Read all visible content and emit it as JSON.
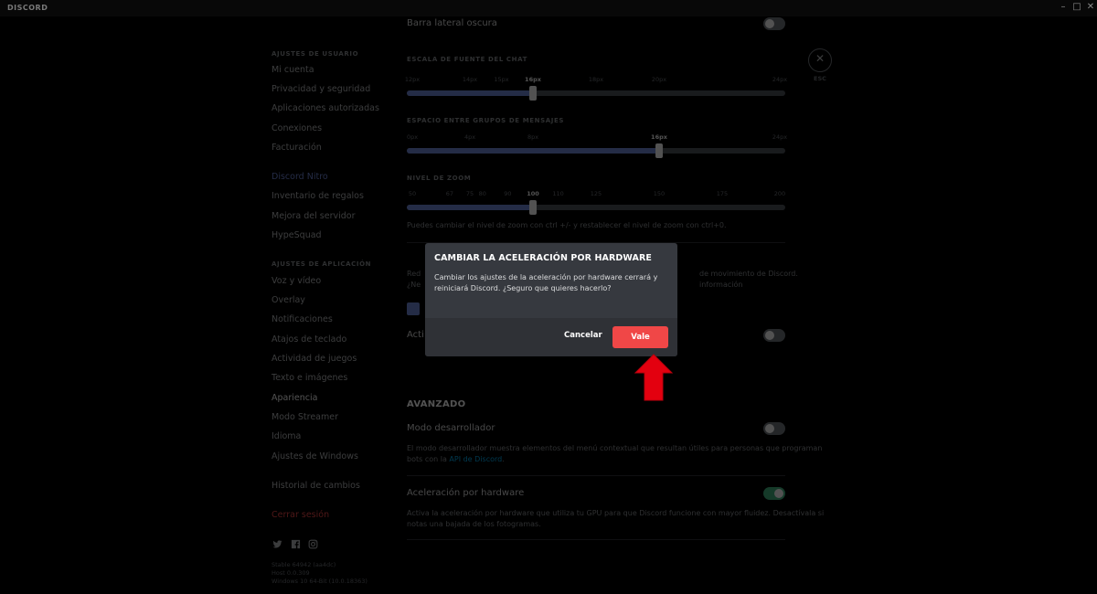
{
  "app": {
    "title": "DISCORD",
    "window_min": "–",
    "window_max": "□",
    "window_close": "✕"
  },
  "sidebar": {
    "user_settings_header": "AJUSTES DE USUARIO",
    "user_items": [
      "Mi cuenta",
      "Privacidad y seguridad",
      "Aplicaciones autorizadas",
      "Conexiones",
      "Facturación"
    ],
    "nitro_item": "Discord Nitro",
    "mid_items": [
      "Inventario de regalos",
      "Mejora del servidor",
      "HypeSquad"
    ],
    "app_settings_header": "AJUSTES DE APLICACIÓN",
    "app_items": [
      "Voz y vídeo",
      "Overlay",
      "Notificaciones",
      "Atajos de teclado",
      "Actividad de juegos",
      "Texto e imágenes",
      "Apariencia",
      "Modo Streamer",
      "Idioma",
      "Ajustes de Windows"
    ],
    "changelog": "Historial de cambios",
    "logout": "Cerrar sesión",
    "social_icons": [
      "twitter-icon",
      "facebook-icon",
      "instagram-icon"
    ],
    "footer": [
      "Stable 64942 (aa4dc)",
      "Host 0.0.309",
      "Windows 10 64-Bit (10.0.18363)"
    ]
  },
  "main": {
    "dark_sidebar_label": "Barra lateral oscura",
    "font_scale": {
      "label": "ESCALA DE FUENTE DEL CHAT",
      "ticks": [
        "12px",
        "14px",
        "15px",
        "16px",
        "18px",
        "20px",
        "24px"
      ],
      "selected_index": 3
    },
    "group_spacing": {
      "label": "ESPACIO ENTRE GRUPOS DE MENSAJES",
      "ticks": [
        "0px",
        "4px",
        "8px",
        "16px",
        "24px"
      ],
      "selected_index": 3
    },
    "zoom": {
      "label": "NIVEL DE ZOOM",
      "ticks": [
        "50",
        "67",
        "75",
        "80",
        "90",
        "100",
        "110",
        "125",
        "150",
        "175",
        "200"
      ],
      "selected_index": 5,
      "hint": "Puedes cambiar el nivel de zoom con ctrl +/- y restablecer el nivel de zoom con ctrl+0."
    },
    "partial_lines": [
      "Red",
      "¿Ne",
      "de movimiento de Discord.",
      "información"
    ],
    "activity_row_label": "Acti",
    "advanced": {
      "header": "AVANZADO",
      "dev_mode_title": "Modo desarrollador",
      "dev_mode_desc_1": "El modo desarrollador muestra elementos del menú contextual que resultan útiles para personas que programan",
      "dev_mode_desc_2_prefix": "bots con la ",
      "dev_mode_desc_link": "API de Discord",
      "dev_mode_desc_2_suffix": ".",
      "hw_accel_title": "Aceleración por hardware",
      "hw_accel_desc_1": "Activa la aceleración por hardware que utiliza tu GPU para que Discord funcione con mayor fluidez. Desactívala si",
      "hw_accel_desc_2": "notas una bajada de los fotogramas."
    },
    "close_label": "ESC"
  },
  "modal": {
    "title": "CAMBIAR LA ACELERACIÓN POR HARDWARE",
    "body": "Cambiar los ajustes de la aceleración por hardware cerrará y reiniciará Discord. ¿Seguro que quieres hacerlo?",
    "cancel_label": "Cancelar",
    "confirm_label": "Vale"
  },
  "colors": {
    "accent": "#7289da",
    "danger": "#f04747",
    "success": "#43b581",
    "modal_bg": "#36393f",
    "arrow": "#e3000f"
  }
}
